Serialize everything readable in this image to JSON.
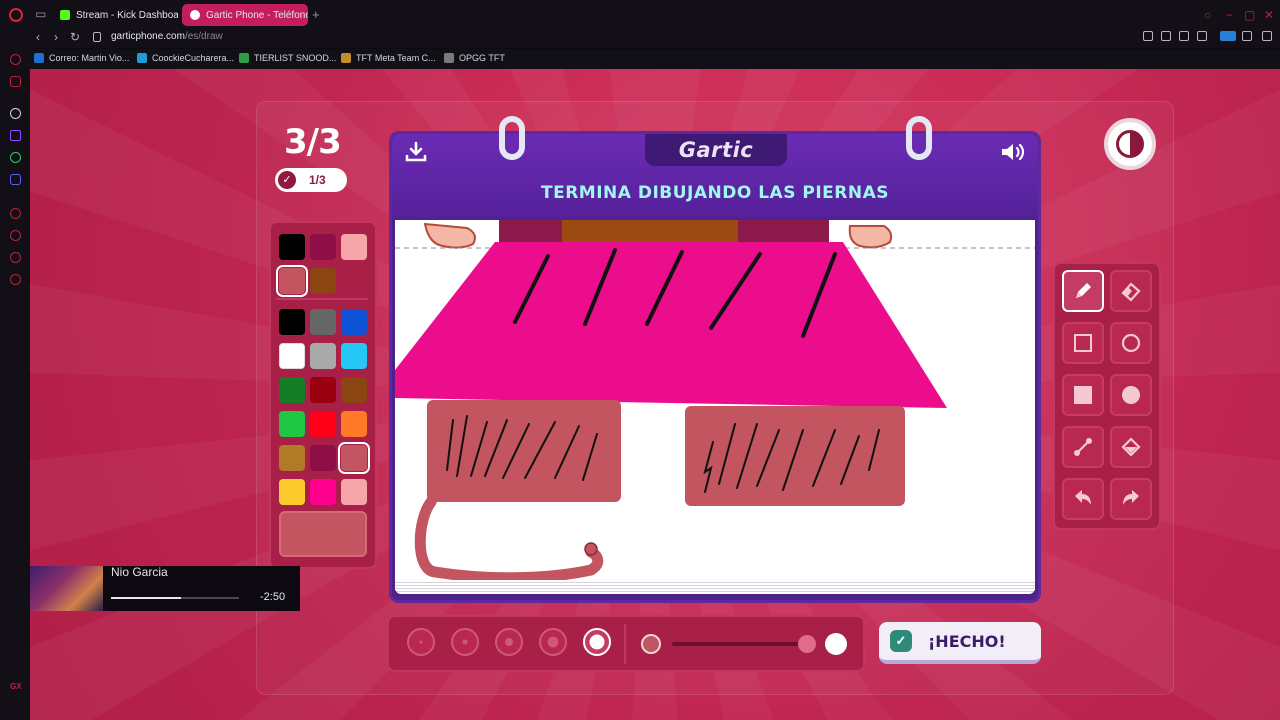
{
  "browser": {
    "tabs": [
      {
        "label": "Stream - Kick Dashboard"
      },
      {
        "label": "Gartic Phone - Teléfono De..."
      }
    ],
    "url_host": "garticphone.com",
    "url_path": "/es/draw",
    "bookmarks": [
      {
        "label": "Correo: Martin Vio...",
        "color": "#1f6fd6"
      },
      {
        "label": "CoockieCucharera...",
        "color": "#1d9bd8"
      },
      {
        "label": "TIERLIST SNOOD...",
        "color": "#2e9d45"
      },
      {
        "label": "TFT Meta Team C...",
        "color": "#c68b2c"
      },
      {
        "label": "OPGG TFT",
        "color": "#7a7a7a"
      }
    ]
  },
  "game": {
    "round": "3/3",
    "sub_round": "1/3",
    "logo": "Gartic",
    "prompt": "TERMINA DIBUJANDO LAS PIERNAS",
    "done_label": "¡HECHO!",
    "current_color": "#c25560",
    "recent_colors": [
      "#000000",
      "#8e0f45",
      "#f6a6a8",
      "#c25560",
      "#8a4513"
    ],
    "palette_colors": [
      "#000000",
      "#666666",
      "#0f52d6",
      "#ffffff",
      "#a9a9a9",
      "#25c8f6",
      "#137d26",
      "#990010",
      "#8a4513",
      "#1fc744",
      "#ff0019",
      "#ff7a28",
      "#b07a27",
      "#8e0f45",
      "#c25560",
      "#fecb2f",
      "#ff008f",
      "#f6a6a8"
    ],
    "selected_palette_color": "#c25560",
    "brush_sizes": 5,
    "selected_brush_size": 5,
    "opacity_level": 0.9,
    "tools": [
      "pencil",
      "eraser",
      "rectangle-outline",
      "ellipse-outline",
      "rectangle-filled",
      "ellipse-filled",
      "line",
      "fill-bucket",
      "undo",
      "redo"
    ],
    "active_tool": "pencil"
  },
  "media": {
    "artist": "Nio Garcia",
    "time_remaining": "-2:50",
    "progress": 0.55
  }
}
